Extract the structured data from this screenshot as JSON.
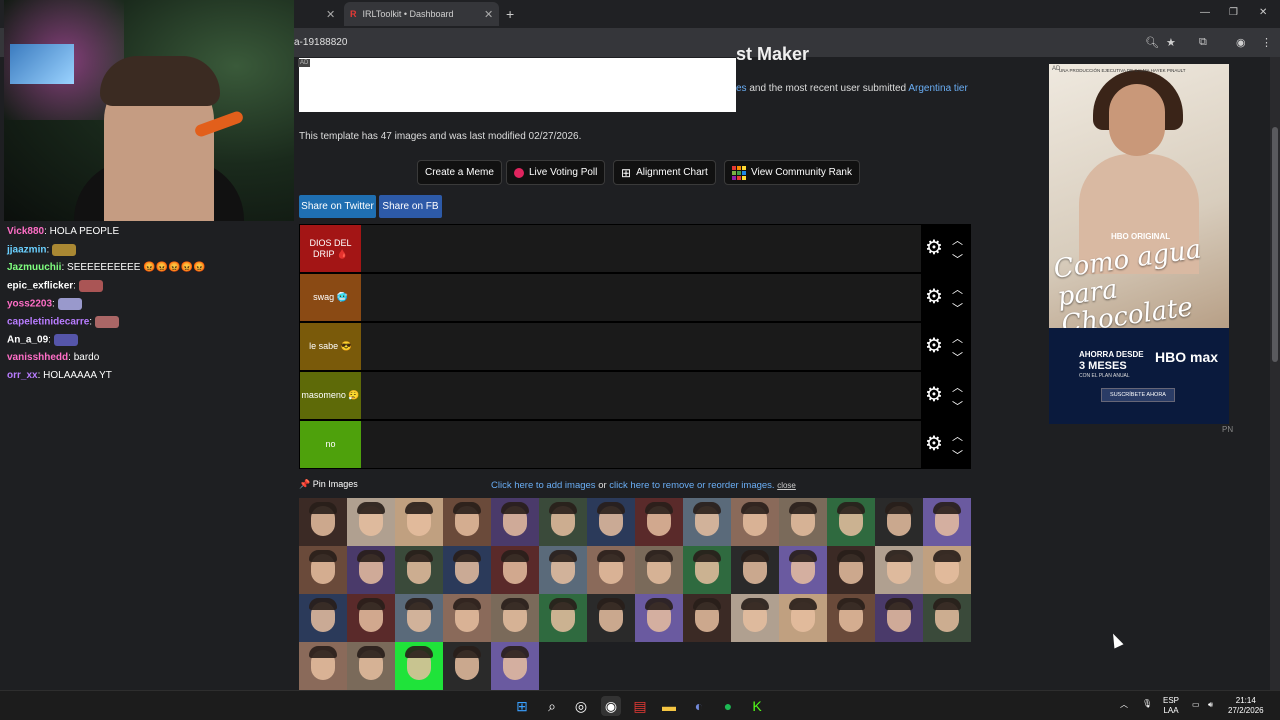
{
  "browser": {
    "tabs": [
      {
        "label": ""
      },
      {
        "label": "IRLToolkit • Dashboard"
      }
    ],
    "url": "a-19188820"
  },
  "stream": {
    "chat": [
      {
        "user": "Vick880",
        "message": "HOLA PEOPLE",
        "color": "#ff6ec7"
      },
      {
        "user": "jjaazmin",
        "message": "",
        "color": "#6ad0ff"
      },
      {
        "user": "Jazmuuchii",
        "message": "SEEEEEEEEEE 😡😡😡😡😡",
        "color": "#7fff7f"
      },
      {
        "user": "epic_exflicker",
        "message": "",
        "color": "#ffffff"
      },
      {
        "user": "yoss2203",
        "message": "",
        "color": "#ff6ec7"
      },
      {
        "user": "capeletinidecarre",
        "message": "",
        "color": "#b87cff"
      },
      {
        "user": "An_a_09",
        "message": "",
        "color": "#ffffff"
      },
      {
        "user": "vanisshhedd",
        "message": "bardo",
        "color": "#ff6ec7"
      },
      {
        "user": "orr_xx",
        "message": "HOLAAAAA YT",
        "color": "#b87cff"
      }
    ]
  },
  "page": {
    "heading_fragment": "st Maker",
    "ad_label": "AD",
    "intro_prefix_link": "es",
    "intro_text": "and the most recent user submitted",
    "intro_link": "Argentina tier",
    "template_info": "This template has 47 images and was last modified 02/27/2026.",
    "buttons": {
      "create_meme": "Create a Meme",
      "live_voting": "Live Voting Poll",
      "alignment": "Alignment Chart",
      "community_rank": "View Community Rank"
    },
    "share": {
      "twitter": "Share on Twitter",
      "fb": "Share on FB"
    },
    "tiers": [
      {
        "label": "DIOS DEL DRIP 🩸",
        "color": "#a31515"
      },
      {
        "label": "swag 🥶",
        "color": "#8a4a14"
      },
      {
        "label": "le sabe 😎",
        "color": "#7a5a0a"
      },
      {
        "label": "masomeno 😮‍💨",
        "color": "#5e6a08"
      },
      {
        "label": "no",
        "color": "#4ea10c"
      }
    ],
    "pin_images": "Pin Images",
    "add_images_link": "Click here to add images",
    "or_text": "or",
    "remove_link": "click here to remove or reorder images.",
    "close": "close",
    "image_count_shown": 47
  },
  "side_ad": {
    "ad_label": "AD",
    "production": "UNA PRODUCCIÓN EJECUTIVA DE SALMA HAYEK PINAULT",
    "hbo_original": "HBO ORIGINAL",
    "title": "Como agua para Chocolate",
    "promo_line1": "AHORRA DESDE",
    "promo_line2": "3 MESES",
    "promo_line3": "CON EL PLAN ANUAL",
    "logo": "HBO max",
    "cta": "SUSCRÍBETE AHORA",
    "pn": "PN"
  },
  "taskbar": {
    "lang1": "ESP",
    "lang2": "LAA",
    "time": "21:14",
    "date": "27/2/2026"
  }
}
